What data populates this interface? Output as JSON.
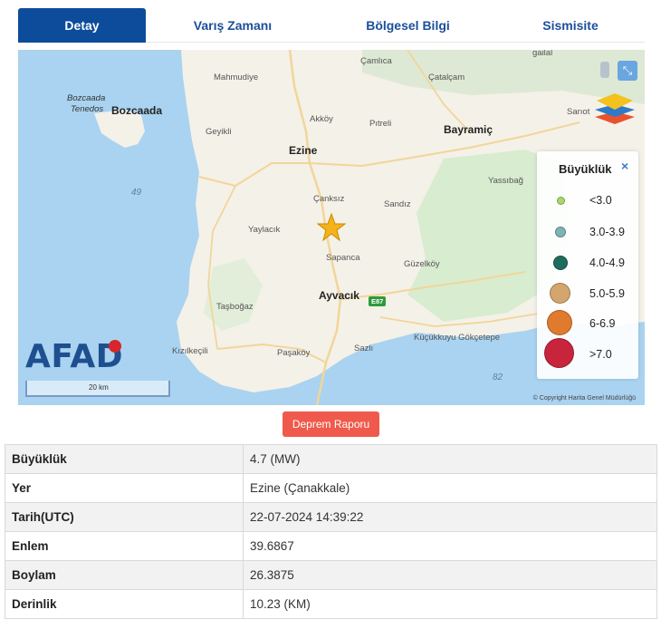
{
  "tabs": [
    {
      "label": "Detay",
      "active": true
    },
    {
      "label": "Varış Zamanı",
      "active": false
    },
    {
      "label": "Bölgesel Bilgi",
      "active": false
    },
    {
      "label": "Sismisite",
      "active": false
    }
  ],
  "map": {
    "places": {
      "bozcaada": "Bozcaada",
      "bozcaada_alt1": "Bozcaada",
      "bozcaada_alt2": "Tenedos",
      "mahmudiye": "Mahmudiye",
      "camlica": "Çamlıca",
      "catalcam": "Çatalçam",
      "geyikli": "Geyikli",
      "akkoy": "Akköy",
      "pitreli": "Pıtreli",
      "bayramic": "Bayramiç",
      "sarnot": "Sarıot",
      "ezine": "Ezine",
      "yassibag": "Yassıbağ",
      "canksiz": "Çanksız",
      "sandiz": "Sandız",
      "yaylacik": "Yaylacık",
      "sapanca": "Sapanca",
      "guzelkoy": "Güzelköy",
      "ayvacik": "Ayvacık",
      "tasbogaz": "Taşboğaz",
      "kizilkecili": "Kızılkeçili",
      "pasakoy": "Paşaköy",
      "sazli": "Sazlı",
      "kucukkuyu": "Küçükkuyu Gökçetepe",
      "galial": "gailal"
    },
    "sea_labels": {
      "west": "49",
      "south": "82"
    },
    "road_badge": "E87",
    "scale": "20 km",
    "copyright": "© Copyright Harita Genel Müdürlüğü",
    "logo": "AFAD",
    "legend": {
      "title": "Büyüklük",
      "close": "×",
      "items": [
        {
          "label": "<3.0",
          "color": "#a6d96a"
        },
        {
          "label": "3.0-3.9",
          "color": "#7fb3b5"
        },
        {
          "label": "4.0-4.9",
          "color": "#1f6b5e"
        },
        {
          "label": "5.0-5.9",
          "color": "#d3a56f"
        },
        {
          "label": "6-6.9",
          "color": "#e07a2e"
        },
        {
          "label": ">7.0",
          "color": "#c8243b"
        }
      ]
    },
    "epicenter_icon": "star-icon"
  },
  "report_button": "Deprem Raporu",
  "details": [
    {
      "key": "Büyüklük",
      "value": "4.7 (MW)"
    },
    {
      "key": "Yer",
      "value": "Ezine (Çanakkale)"
    },
    {
      "key": "Tarih(UTC)",
      "value": "22-07-2024 14:39:22"
    },
    {
      "key": "Enlem",
      "value": "39.6867"
    },
    {
      "key": "Boylam",
      "value": "26.3875"
    },
    {
      "key": "Derinlik",
      "value": "10.23 (KM)"
    }
  ]
}
